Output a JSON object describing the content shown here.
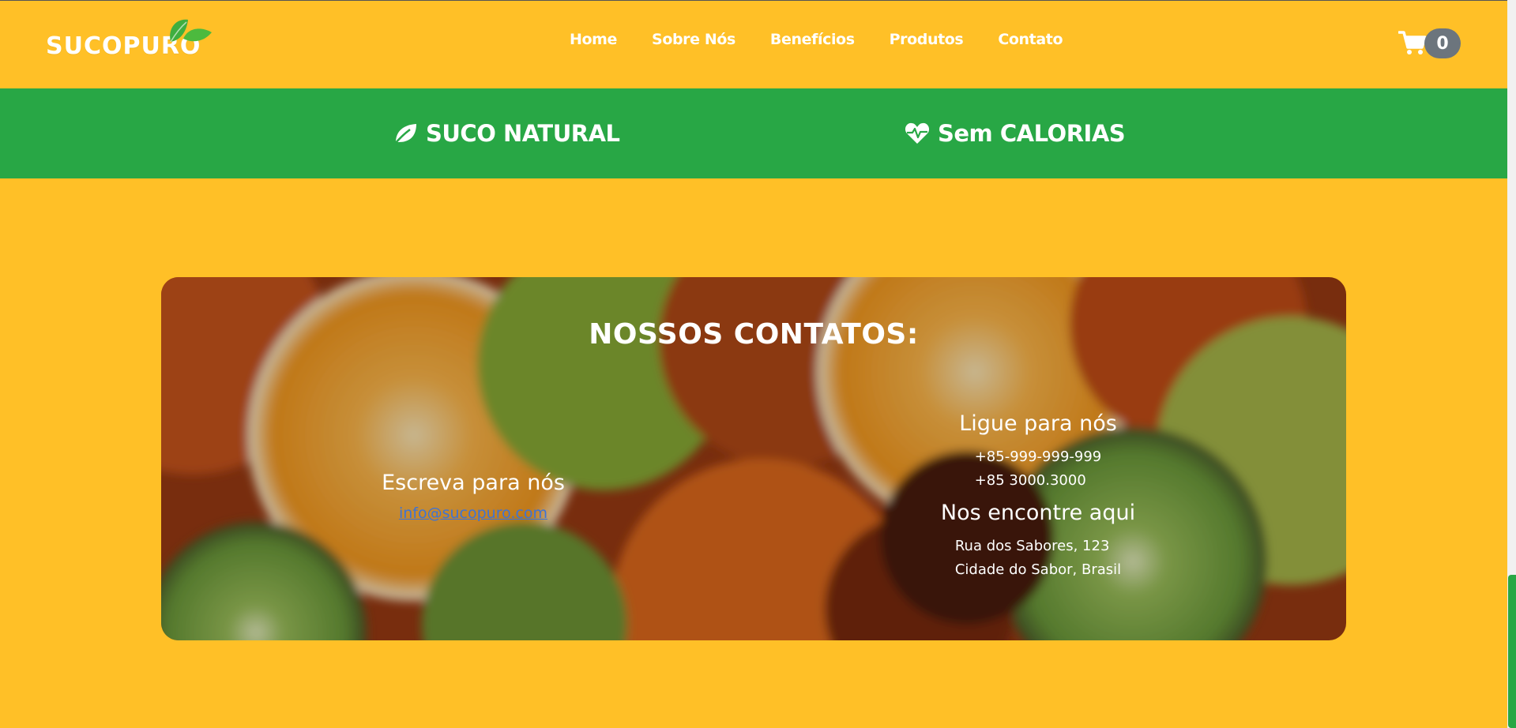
{
  "brand": {
    "name": "SUCOPURO",
    "primary": "#ffc027",
    "green": "#28a745",
    "badge": "#6c757d"
  },
  "nav": {
    "items": [
      "Home",
      "Sobre Nós",
      "Benefícios",
      "Produtos",
      "Contato"
    ]
  },
  "cart": {
    "icon": "cart-icon",
    "count": "0"
  },
  "features": [
    {
      "icon": "leaf-icon",
      "label": "SUCO NATURAL"
    },
    {
      "icon": "heartbeat-icon",
      "label": "Sem CALORIAS"
    }
  ],
  "contact": {
    "title": "NOSSOS CONTATOS:",
    "write": {
      "heading": "Escreva para nós",
      "email": "info@sucopuro.com"
    },
    "call": {
      "heading": "Ligue para nós",
      "phones": [
        "+85-999-999-999",
        "+85 3000.3000"
      ]
    },
    "find": {
      "heading": "Nos encontre aqui",
      "address": [
        "Rua dos Sabores, 123",
        "Cidade do Sabor, Brasil"
      ]
    }
  }
}
